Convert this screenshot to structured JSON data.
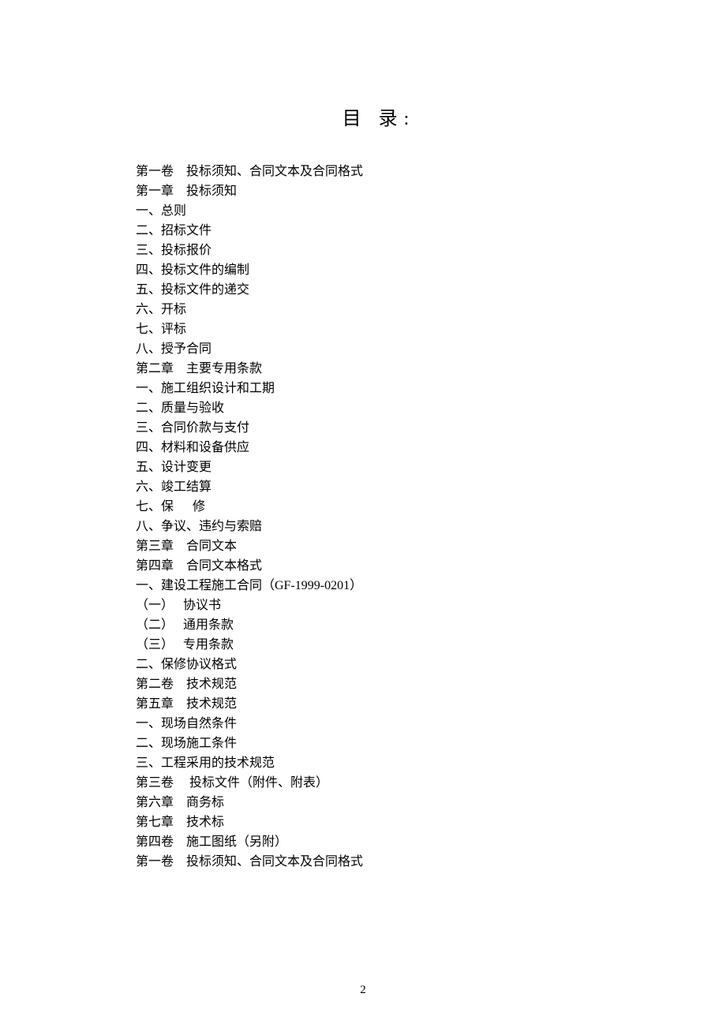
{
  "title": "目  录:",
  "toc": [
    "第一卷    投标须知、合同文本及合同格式",
    "第一章    投标须知",
    "一、总则",
    "二、招标文件",
    "三、投标报价",
    "四、投标文件的编制",
    "五、投标文件的递交",
    "六、开标",
    "七、评标",
    "八、授予合同",
    "第二章    主要专用条款",
    "一、施工组织设计和工期",
    "二、质量与验收",
    "三、合同价款与支付",
    "四、材料和设备供应",
    "五、设计变更",
    "六、竣工结算",
    "七、保      修",
    "八、争议、违约与索赔",
    "第三章    合同文本",
    "第四章    合同文本格式",
    "一、建设工程施工合同（GF-1999-0201）",
    "（一）   协议书",
    "（二）   通用条款",
    "（三）   专用条款",
    "二、保修协议格式",
    "第二卷    技术规范",
    "第五章    技术规范",
    "一、现场自然条件",
    "二、现场施工条件",
    "三、工程采用的技术规范",
    "第三卷     投标文件（附件、附表）",
    "第六章    商务标",
    "第七章    技术标",
    "第四卷    施工图纸（另附）",
    "第一卷    投标须知、合同文本及合同格式"
  ],
  "page_number": "2"
}
